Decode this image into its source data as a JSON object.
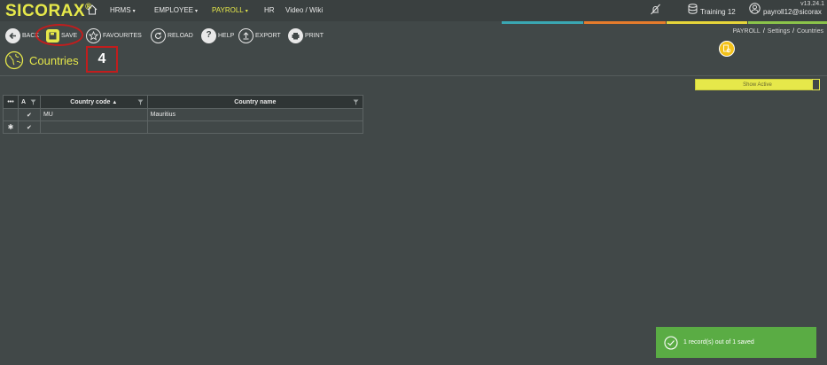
{
  "app": {
    "logo_text": "SICORAX",
    "logo_mark": "®",
    "version": "v13.24.1"
  },
  "nav": {
    "items": [
      {
        "label": "HRMS",
        "has_caret": true
      },
      {
        "label": "EMPLOYEE",
        "has_caret": true
      },
      {
        "label": "PAYROLL",
        "has_caret": true,
        "active": true
      },
      {
        "label": "HR",
        "has_caret": false
      },
      {
        "label": "Video / Wiki",
        "has_caret": false
      }
    ],
    "caret": "▾"
  },
  "top_right": {
    "database_label": "Training 12",
    "user_label": "payroll12@sicorax"
  },
  "toolbar": {
    "back_label": "BACK",
    "save_label": "SAVE",
    "favourites_label": "FAVOURITES",
    "reload_label": "RELOAD",
    "help_label": "HELP",
    "export_label": "EXPORT",
    "print_label": "PRINT"
  },
  "breadcrumb": {
    "items": [
      "PAYROLL",
      "Settings",
      "Countries"
    ],
    "separator": "/"
  },
  "page": {
    "title": "Countries",
    "step_number": "4"
  },
  "filter_toggle": {
    "label": "Show Active"
  },
  "grid": {
    "columns": {
      "menu": "•••",
      "active": "A",
      "code": "Country code",
      "code_sort": "▲",
      "name": "Country name"
    },
    "rows": [
      {
        "marker": "",
        "active": "✔",
        "code": "MU",
        "name": "Mauritius"
      }
    ],
    "new_row": {
      "marker": "✱",
      "active": "✔",
      "code": "",
      "name": ""
    }
  },
  "toast": {
    "message": "1 record(s) out of 1 saved"
  },
  "colors": {
    "accent": "#e6e84a",
    "background": "#414848",
    "toast_success": "#5aac44",
    "annotation_red": "#c21d1d",
    "strip_teal": "#3aa7b3",
    "strip_orange": "#e67c2c",
    "strip_yellow": "#e6d53a",
    "strip_green": "#8bc34a"
  }
}
